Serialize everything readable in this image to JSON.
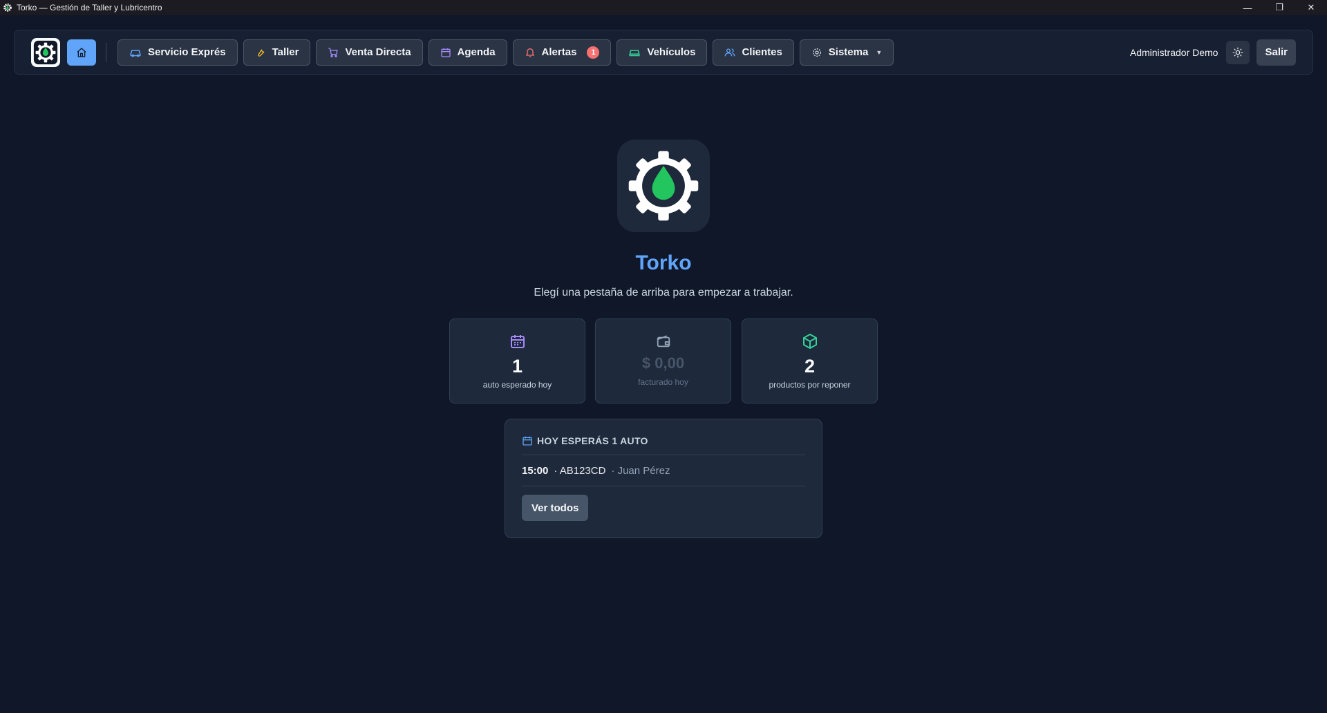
{
  "window": {
    "title": "Torko — Gestión de Taller y Lubricentro",
    "controls": {
      "minimize": "—",
      "restore": "❐",
      "close": "✕"
    }
  },
  "navbar": {
    "items": [
      {
        "label": "Servicio Exprés",
        "icon": "car-icon",
        "color": "#60a5fa"
      },
      {
        "label": "Taller",
        "icon": "wrench-icon",
        "color": "#fbbf24"
      },
      {
        "label": "Venta Directa",
        "icon": "cart-icon",
        "color": "#a78bfa"
      },
      {
        "label": "Agenda",
        "icon": "calendar-icon",
        "color": "#a78bfa"
      },
      {
        "label": "Alertas",
        "icon": "bell-icon",
        "color": "#f87171",
        "badge": "1"
      },
      {
        "label": "Vehículos",
        "icon": "vehicle-icon",
        "color": "#34d399"
      },
      {
        "label": "Clientes",
        "icon": "users-icon",
        "color": "#60a5fa"
      },
      {
        "label": "Sistema",
        "icon": "gear-icon",
        "color": "#d1d5db",
        "caret": "▼"
      }
    ],
    "user_name": "Administrador Demo",
    "logout_label": "Salir"
  },
  "hero": {
    "title": "Torko",
    "subtitle": "Elegí una pestaña de arriba para empezar a trabajar."
  },
  "stats": [
    {
      "value": "1",
      "label": "auto esperado hoy",
      "icon": "calendar-icon",
      "color": "#a78bfa"
    },
    {
      "value": "$ 0,00",
      "label": "facturado hoy",
      "icon": "wallet-icon",
      "color": "#94a3b8"
    },
    {
      "value": "2",
      "label": "productos por reponer",
      "icon": "box-icon",
      "color": "#34d399"
    }
  ],
  "agenda": {
    "heading": "HOY ESPERÁS 1 AUTO",
    "entries": [
      {
        "time": "15:00",
        "plate": "· AB123CD",
        "client": "· Juan Pérez"
      }
    ],
    "see_all_label": "Ver todos"
  },
  "colors": {
    "accent": "#60a5fa",
    "oil_drop": "#22c55e",
    "background": "#0f1729"
  }
}
